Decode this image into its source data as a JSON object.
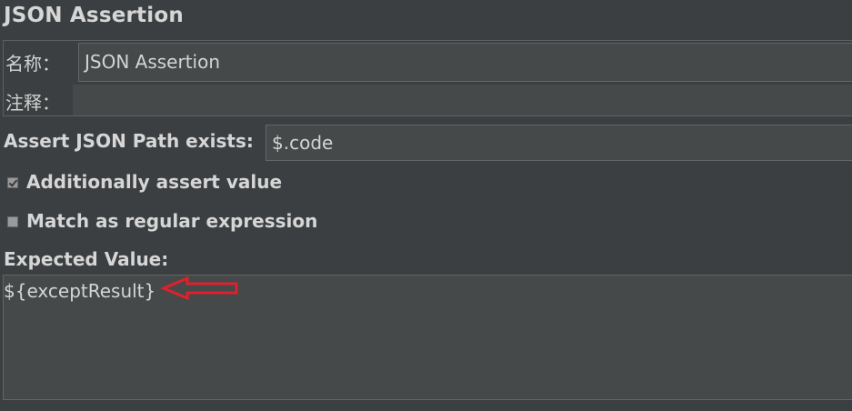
{
  "panel": {
    "title": "JSON Assertion"
  },
  "name_group": {
    "name_label": "名称：",
    "name_value": "JSON Assertion",
    "comment_label": "注释：",
    "comment_value": ""
  },
  "assertion": {
    "path_label": "Assert JSON Path exists:",
    "path_value": "$.code",
    "additionally_assert_label": "Additionally assert value",
    "additionally_assert_checked": true,
    "regex_label": "Match as regular expression",
    "regex_checked": false,
    "expected_label": "Expected Value:",
    "expected_value": "${exceptResult}"
  },
  "annotation": {
    "arrow_icon": "red-left-arrow-icon",
    "arrow_color": "#e0202a"
  },
  "colors": {
    "background": "#3c3f41",
    "field_background": "#45494a",
    "text": "#d4d4d4"
  }
}
